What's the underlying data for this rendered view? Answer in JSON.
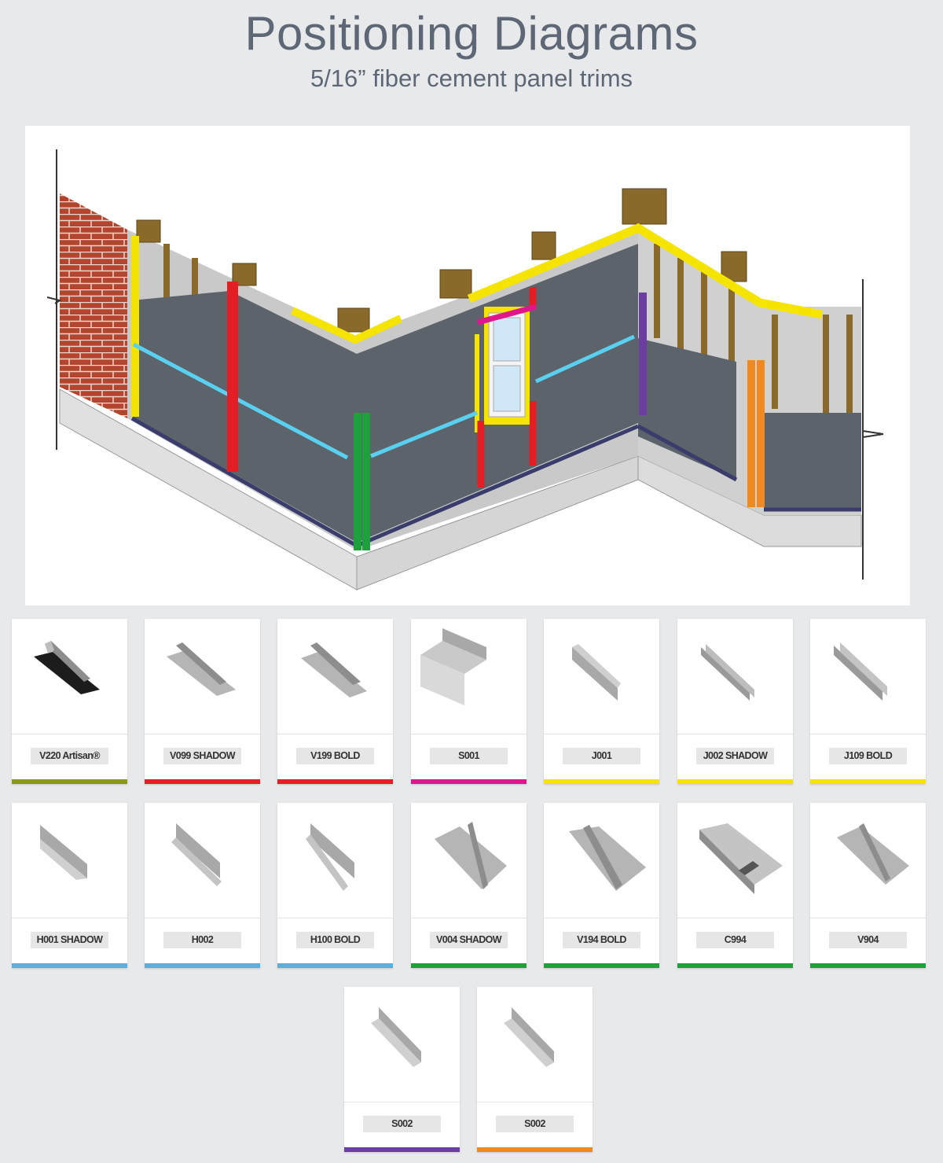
{
  "page": {
    "title": "Positioning Diagrams",
    "subtitle": "5/16” fiber cement panel trims"
  },
  "colors": {
    "olive": "#8c9a1c",
    "red": "#e31e24",
    "magenta": "#e0178c",
    "yellow": "#f5e400",
    "light_blue": "#5aaee0",
    "green": "#1ea03c",
    "purple": "#6a3fa0",
    "orange": "#f08a20",
    "wall_panel": "#5c636a",
    "brick": "#b3452f",
    "stud": "#8a6a2a"
  },
  "products": [
    {
      "label": "V220 Artisan®",
      "color": "#8c9a1c",
      "icon": "v220-profile-icon"
    },
    {
      "label": "V099 SHADOW",
      "color": "#e31e24",
      "icon": "v099-profile-icon"
    },
    {
      "label": "V199 BOLD",
      "color": "#e31e24",
      "icon": "v199-profile-icon"
    },
    {
      "label": "S001",
      "color": "#e0178c",
      "icon": "s001-profile-icon"
    },
    {
      "label": "J001",
      "color": "#f5e400",
      "icon": "j001-profile-icon"
    },
    {
      "label": "J002 SHADOW",
      "color": "#f5e400",
      "icon": "j002-profile-icon"
    },
    {
      "label": "J109 BOLD",
      "color": "#f5e400",
      "icon": "j109-profile-icon"
    },
    {
      "label": "H001 SHADOW",
      "color": "#5aaee0",
      "icon": "h001-profile-icon"
    },
    {
      "label": "H002",
      "color": "#5aaee0",
      "icon": "h002-profile-icon"
    },
    {
      "label": "H100 BOLD",
      "color": "#5aaee0",
      "icon": "h100-profile-icon"
    },
    {
      "label": "V004 SHADOW",
      "color": "#1ea03c",
      "icon": "v004-profile-icon"
    },
    {
      "label": "V194 BOLD",
      "color": "#1ea03c",
      "icon": "v194-profile-icon"
    },
    {
      "label": "C994",
      "color": "#1ea03c",
      "icon": "c994-profile-icon"
    },
    {
      "label": "V904",
      "color": "#1ea03c",
      "icon": "v904-profile-icon"
    },
    {
      "label": "S002",
      "color": "#6a3fa0",
      "icon": "s002-profile-icon"
    },
    {
      "label": "S002",
      "color": "#f08a20",
      "icon": "s002-profile-icon"
    }
  ]
}
